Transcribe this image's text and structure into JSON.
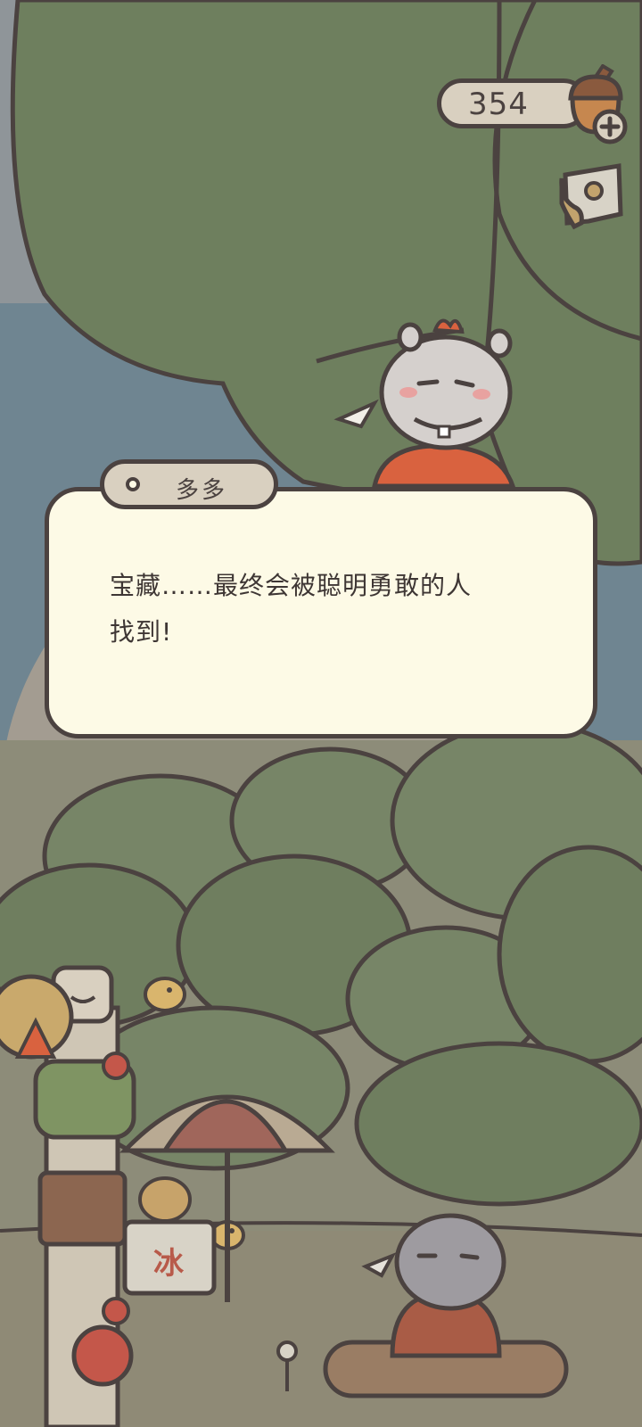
{
  "hud": {
    "acorn_count": "354"
  },
  "dialog": {
    "speaker": "多多",
    "line_1": "宝藏……最终会被聪明勇敢的人",
    "line_2": "找到!"
  },
  "stand_sign": "冰",
  "icons": [
    "acorn-plus-icon",
    "map-icon"
  ],
  "colors": {
    "outline": "#4b4240",
    "dialog_bg": "#fdfae6",
    "tab_bg": "#d9d0c0",
    "tree_green": "#6e7f5e",
    "sky_blue": "#6f8591"
  }
}
